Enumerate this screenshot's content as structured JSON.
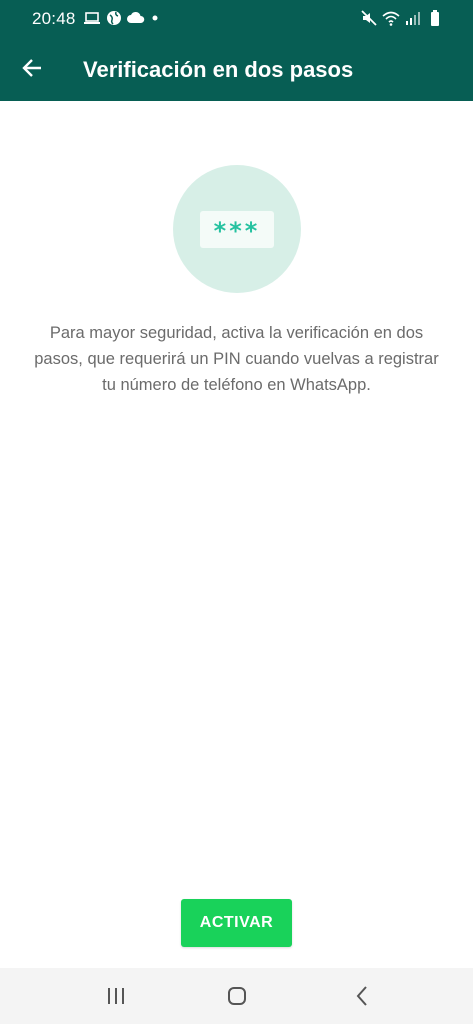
{
  "status_bar": {
    "time": "20:48",
    "left_icons": [
      "laptop-icon",
      "globe-icon",
      "cloud-icon",
      "dot-icon"
    ],
    "right_icons": [
      "mute-icon",
      "wifi-icon",
      "signal-icon",
      "battery-icon"
    ]
  },
  "app_bar": {
    "back_icon": "arrow-left-icon",
    "title": "Verificación en dos pasos"
  },
  "illustration": {
    "pin_text": "***"
  },
  "description": "Para mayor seguridad, activa la verificación en dos pasos, que requerirá un PIN cuando vuelvas a registrar tu número de teléfono en WhatsApp.",
  "activate_button": "ACTIVAR",
  "nav_bar": {
    "buttons": [
      "recent-apps-icon",
      "home-icon",
      "back-icon"
    ]
  },
  "colors": {
    "primary": "#075e54",
    "accent": "#25d366",
    "illustration_bg": "#d7efe7",
    "asterisk": "#25c2a0",
    "text_secondary": "#6b6b6b",
    "nav_bg": "#f4f4f4"
  }
}
